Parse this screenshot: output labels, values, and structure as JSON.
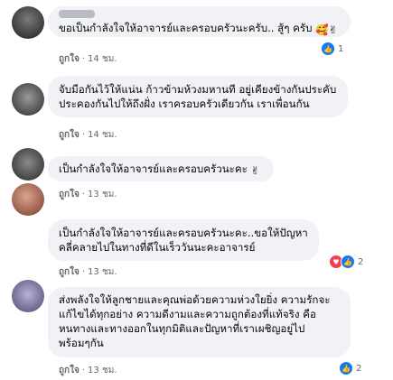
{
  "comments": [
    {
      "text_lines": [
        "ขอเป็นกำลังใจให้อาจารย์และครอบครัวนะครับ.. สู้ๆ ครับ"
      ],
      "emojis": [
        "🥰",
        "✌"
      ],
      "like_label": "ถูกใจ",
      "time": "14 ชม.",
      "reaction_count": "1"
    },
    {
      "text_lines": [
        "จับมือกันไว้ให้แน่น ก้าวข้ามห้วงมหานที อยู่เคียงข้างกันประคับ",
        "ประคองกันไปให้ถึงฝั่ง เราครอบครัวเดียวกัน เราเพื่อนกัน"
      ],
      "emojis": [],
      "like_label": "ถูกใจ",
      "time": "14 ชม.",
      "reaction_count": ""
    },
    {
      "text_lines": [
        "เป็นกำลังใจให้อาจารย์และครอบครัวนะคะ"
      ],
      "emojis": [
        "✌"
      ],
      "like_label": "ถูกใจ",
      "time": "13 ชม.",
      "reaction_count": ""
    },
    {
      "text_lines": [
        "เป็นกำลังใจให้อาจารย์และครอบครัวนะคะ..ขอให้ปัญหา",
        "คลี่คลายไปในทางที่ดีในเร็ววันนะคะอาจารย์"
      ],
      "emojis": [],
      "like_label": "ถูกใจ",
      "time": "13 ชม.",
      "reaction_count": "2"
    },
    {
      "text_lines": [
        "ส่งพลังใจให้ลูกชายและคุณพ่อด้วยความห่วงใยยิ่ง ความรักจะ",
        "แก้ไขได้ทุกอย่าง ความดีงามและความถูกต้องที่แท้จริง คือ",
        "หนทางและทางออกในทุกมิติและปัญหาที่เราเผชิญอยู่ไป",
        "พร้อมๆกัน"
      ],
      "emojis": [],
      "like_label": "ถูกใจ",
      "time": "13 ชม.",
      "reaction_count": "2"
    }
  ],
  "dot": "·",
  "colors": {
    "bubble": "#f0f2f5",
    "like_blue": "#1877f2",
    "love_red": "#f33e58"
  }
}
